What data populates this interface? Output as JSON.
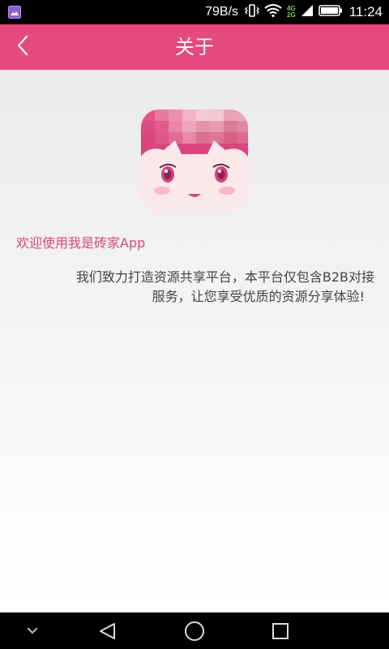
{
  "status_bar": {
    "net_speed": "79B/s",
    "net_type_top": "4G",
    "net_type_bottom": "2G",
    "time": "11:24",
    "icons": [
      "gallery-icon",
      "vibrate-icon",
      "wifi-icon",
      "signal-icon",
      "battery-icon"
    ]
  },
  "header": {
    "title": "关于",
    "back_icon": "chevron-left-icon",
    "background": "#e4497f"
  },
  "content": {
    "logo": "app-logo",
    "welcome": "欢迎使用我是砖家App",
    "description_line1": "我们致力打造资源共享平台，本平台仅包含B2B对接",
    "description_line2": "服务，让您享受优质的资源分享体验!"
  },
  "nav_bar": {
    "icons": [
      "chevron-down-icon",
      "back-triangle-icon",
      "home-circle-icon",
      "recents-square-icon"
    ]
  },
  "colors": {
    "accent": "#e4497f",
    "welcome_text": "#d94778"
  }
}
